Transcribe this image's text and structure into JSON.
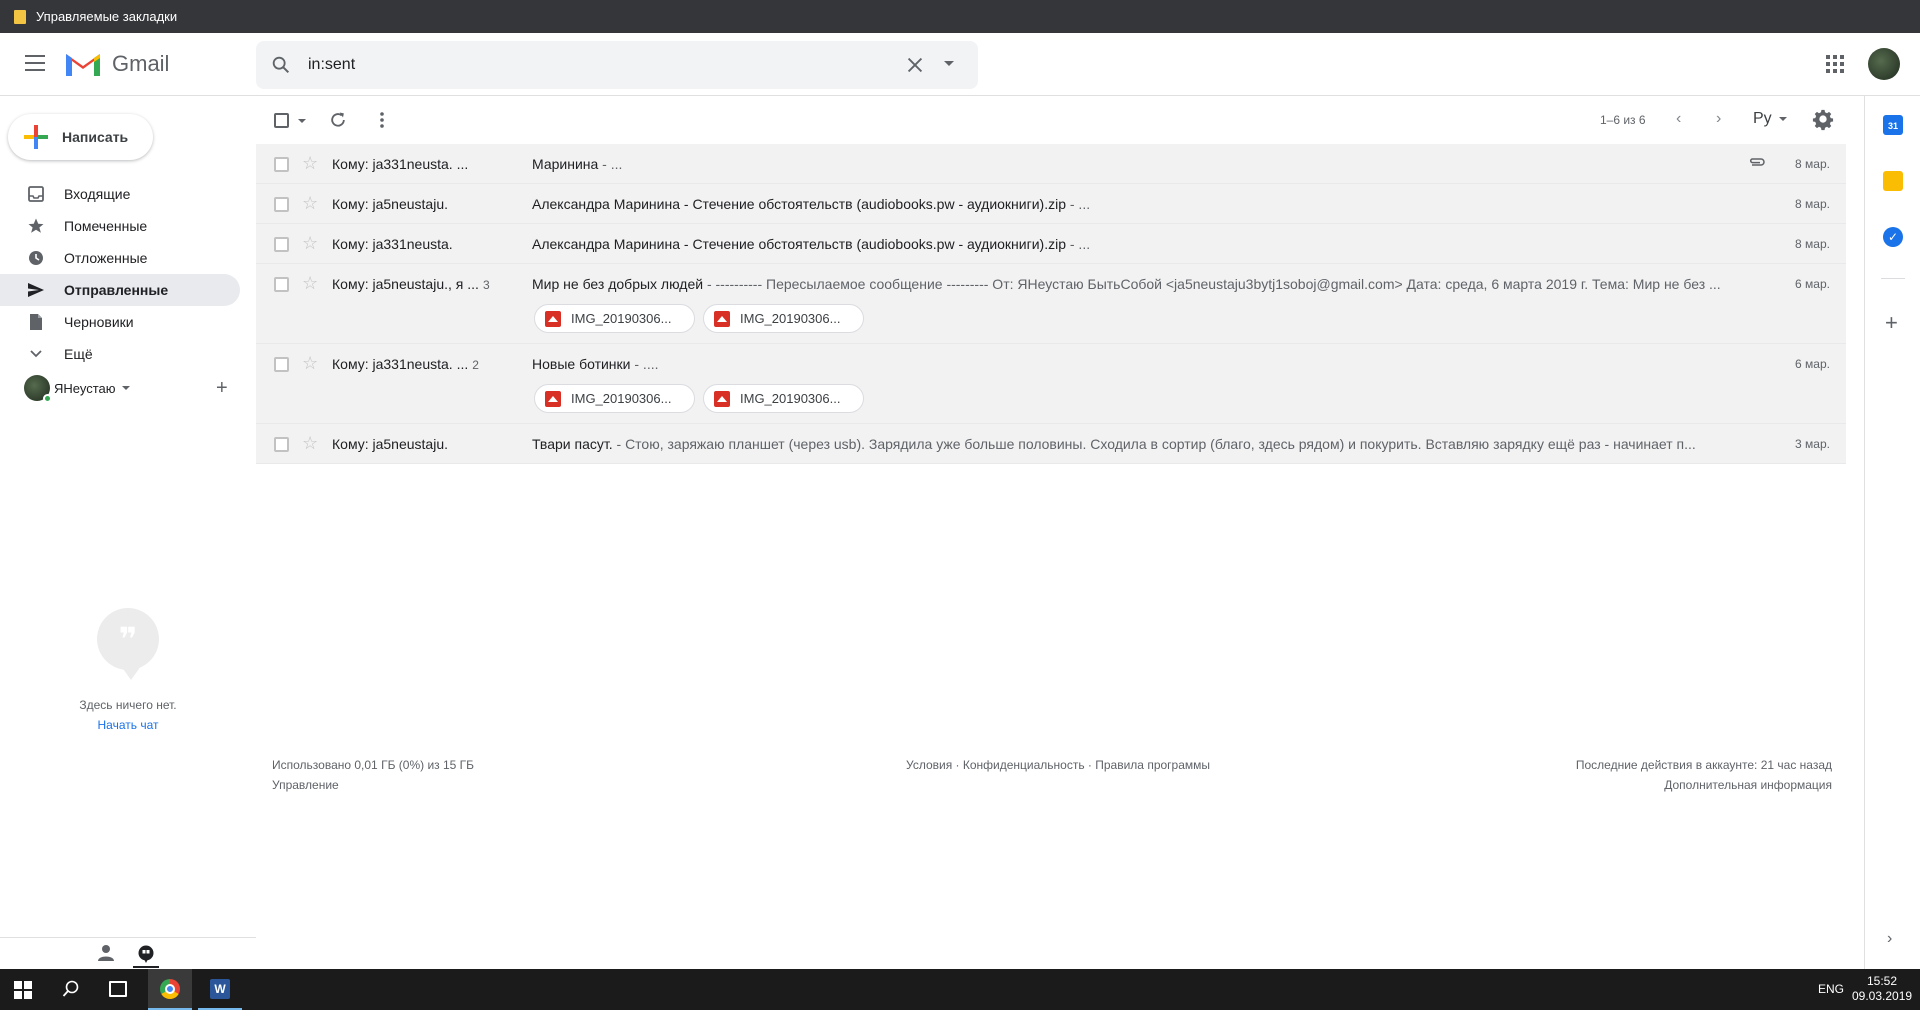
{
  "browser": {
    "bookmarks_label": "Управляемые закладки"
  },
  "header": {
    "logo_text": "Gmail",
    "search_value": "in:sent"
  },
  "sidebar": {
    "compose_label": "Написать",
    "items": [
      {
        "label": "Входящие",
        "icon": "inbox-icon"
      },
      {
        "label": "Помеченные",
        "icon": "star-icon"
      },
      {
        "label": "Отложенные",
        "icon": "clock-icon"
      },
      {
        "label": "Отправленные",
        "icon": "send-icon"
      },
      {
        "label": "Черновики",
        "icon": "draft-icon"
      },
      {
        "label": "Ещё",
        "icon": "chevron-down-icon"
      }
    ],
    "active_index": 3,
    "user_name": "ЯНеустаю",
    "hangouts_empty": "Здесь ничего нет.",
    "hangouts_start": "Начать чат"
  },
  "toolbar": {
    "count": "1–6 из 6",
    "lang": "Ру"
  },
  "emails": [
    {
      "sender": "Кому: ja331neusta. ...",
      "count": "",
      "subject": "Маринина",
      "snippet": " - ...",
      "date": "8 мар.",
      "attachment_clip": true,
      "chips": []
    },
    {
      "sender": "Кому: ja5neustaju.",
      "count": "",
      "subject": "Александра Маринина - Стечение обстоятельств (audiobooks.pw - аудиокниги).zip",
      "snippet": " - ...",
      "date": "8 мар.",
      "attachment_clip": false,
      "chips": []
    },
    {
      "sender": "Кому: ja331neusta.",
      "count": "",
      "subject": "Александра Маринина - Стечение обстоятельств (audiobooks.pw - аудиокниги).zip",
      "snippet": " - ...",
      "date": "8 мар.",
      "attachment_clip": false,
      "chips": []
    },
    {
      "sender": "Кому: ja5neustaju., я ...",
      "count": "3",
      "subject": "Мир не без добрых людей",
      "snippet": " - ---------- Пересылаемое сообщение --------- От: ЯНеустаю БытьСобой <ja5neustaju3bytj1soboj@gmail.com> Дата: среда, 6 марта 2019 г. Тема: Мир не без ...",
      "date": "6 мар.",
      "attachment_clip": false,
      "chips": [
        "IMG_20190306...",
        "IMG_20190306..."
      ]
    },
    {
      "sender": "Кому: ja331neusta. ...",
      "count": "2",
      "subject": "Новые ботинки",
      "snippet": " - ....",
      "date": "6 мар.",
      "attachment_clip": false,
      "chips": [
        "IMG_20190306...",
        "IMG_20190306..."
      ]
    },
    {
      "sender": "Кому: ja5neustaju.",
      "count": "",
      "subject": "Твари пасут.",
      "snippet": " - Стою, заряжаю планшет (через usb). Зарядила уже больше половины. Сходила в сортир (благо, здесь рядом) и покурить. Вставляю зарядку ещё раз - начинает п...",
      "date": "3 мар.",
      "attachment_clip": false,
      "chips": []
    }
  ],
  "footer": {
    "storage": "Использовано 0,01 ГБ (0%) из 15 ГБ",
    "manage": "Управление",
    "links": "Условия · Конфиденциальность · Правила программы",
    "activity": "Последние действия в аккаунте: 21 час назад",
    "details": "Дополнительная информация"
  },
  "rightbar": {
    "calendar_day": "31"
  },
  "taskbar": {
    "lang": "ENG",
    "time": "15:52",
    "date": "09.03.2019"
  }
}
